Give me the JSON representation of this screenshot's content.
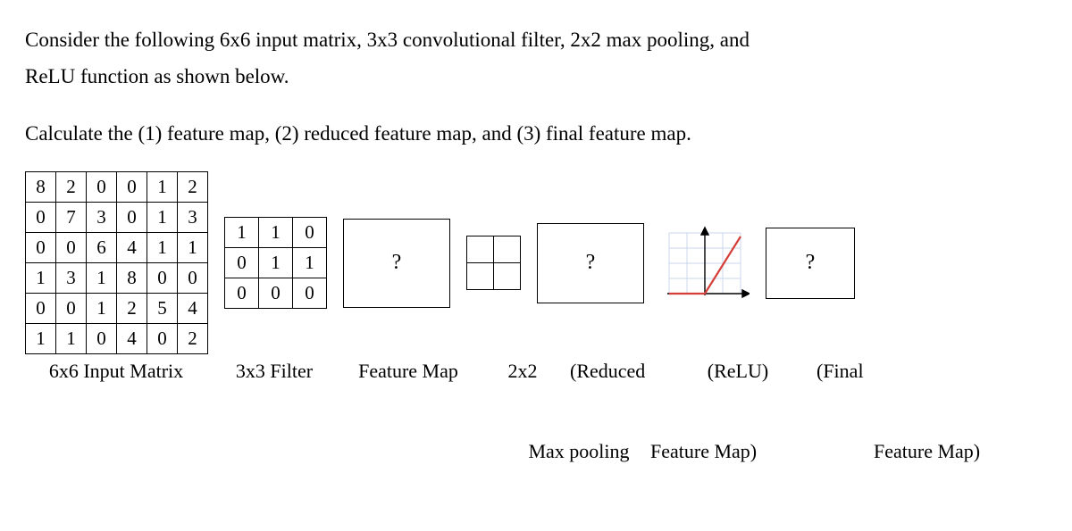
{
  "prompt": {
    "p1": "Consider the following 6x6 input matrix, 3x3 convolutional filter, 2x2 max pooling, and",
    "p2": "ReLU function as shown below.",
    "p3": "Calculate the (1) feature map, (2) reduced feature map, and (3) final feature map."
  },
  "input_matrix": [
    [
      8,
      2,
      0,
      0,
      1,
      2
    ],
    [
      0,
      7,
      3,
      0,
      1,
      3
    ],
    [
      0,
      0,
      6,
      4,
      1,
      1
    ],
    [
      1,
      3,
      1,
      8,
      0,
      0
    ],
    [
      0,
      0,
      1,
      2,
      5,
      4
    ],
    [
      1,
      1,
      0,
      4,
      0,
      2
    ]
  ],
  "filter": [
    [
      1,
      1,
      0
    ],
    [
      0,
      1,
      1
    ],
    [
      0,
      0,
      0
    ]
  ],
  "labels": {
    "input": "6x6 Input Matrix",
    "filter": "3x3 Filter",
    "feature_map": "Feature Map",
    "pool_a": "2x2",
    "pool_b": "Max pooling",
    "reduced_a": "(Reduced",
    "reduced_b": "Feature Map)",
    "relu": "(ReLU)",
    "final_a": "(Final",
    "final_b": "Feature Map)"
  },
  "qmark": "?",
  "chart_data": {
    "type": "table",
    "title": "CNN feature-map computation problem",
    "input_matrix_6x6": [
      [
        8,
        2,
        0,
        0,
        1,
        2
      ],
      [
        0,
        7,
        3,
        0,
        1,
        3
      ],
      [
        0,
        0,
        6,
        4,
        1,
        1
      ],
      [
        1,
        3,
        1,
        8,
        0,
        0
      ],
      [
        0,
        0,
        1,
        2,
        5,
        4
      ],
      [
        1,
        1,
        0,
        4,
        0,
        2
      ]
    ],
    "conv_filter_3x3": [
      [
        1,
        1,
        0
      ],
      [
        0,
        1,
        1
      ],
      [
        0,
        0,
        0
      ]
    ],
    "stages": [
      {
        "name": "Feature Map",
        "known": false
      },
      {
        "name": "2x2 Max pooling",
        "known": false
      },
      {
        "name": "Reduced Feature Map",
        "known": false
      },
      {
        "name": "ReLU activation",
        "known": true,
        "function": "max(0,x)"
      },
      {
        "name": "Final Feature Map",
        "known": false
      }
    ]
  }
}
